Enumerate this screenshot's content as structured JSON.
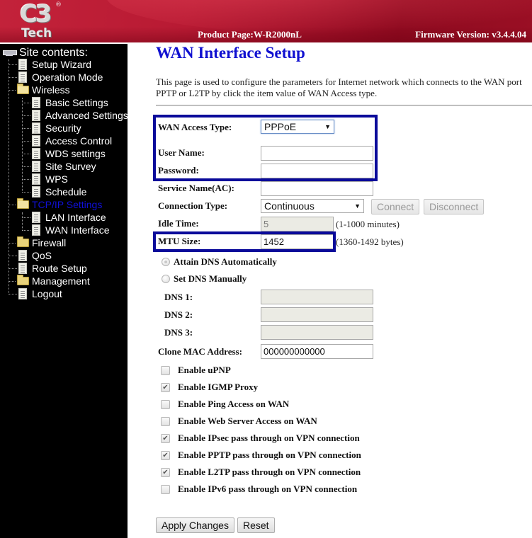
{
  "header": {
    "logo_main": "C3",
    "logo_sub": "Tech",
    "logo_reg": "®",
    "product": "Product Page:W-R2000nL",
    "firmware": "Firmware Version: v3.4.4.04"
  },
  "sidebar": {
    "root_label": "Site contents:",
    "items": [
      {
        "label": "Setup Wizard",
        "icon": "document-icon"
      },
      {
        "label": "Operation Mode",
        "icon": "document-icon"
      },
      {
        "label": "Wireless",
        "icon": "folder-open-icon"
      },
      {
        "label": "Basic Settings",
        "icon": "document-icon"
      },
      {
        "label": "Advanced Settings",
        "icon": "document-icon"
      },
      {
        "label": "Security",
        "icon": "document-icon"
      },
      {
        "label": "Access Control",
        "icon": "document-icon"
      },
      {
        "label": "WDS settings",
        "icon": "document-icon"
      },
      {
        "label": "Site Survey",
        "icon": "document-icon"
      },
      {
        "label": "WPS",
        "icon": "document-icon"
      },
      {
        "label": "Schedule",
        "icon": "document-icon"
      },
      {
        "label": "TCP/IP Settings",
        "icon": "folder-open-icon",
        "active": true
      },
      {
        "label": "LAN Interface",
        "icon": "document-icon"
      },
      {
        "label": "WAN Interface",
        "icon": "document-icon"
      },
      {
        "label": "Firewall",
        "icon": "folder-icon"
      },
      {
        "label": "QoS",
        "icon": "document-icon"
      },
      {
        "label": "Route Setup",
        "icon": "document-icon"
      },
      {
        "label": "Management",
        "icon": "folder-icon"
      },
      {
        "label": "Logout",
        "icon": "document-icon"
      }
    ]
  },
  "main": {
    "title": "WAN Interface Setup",
    "description_line1": "This page is used to configure the parameters for Internet network which connects to the WAN port",
    "description_line2": "PPTP or L2TP by click the item value of WAN Access type.",
    "form": {
      "wan_access_type": {
        "label": "WAN Access Type:",
        "value": "PPPoE"
      },
      "user_name": {
        "label": "User Name:",
        "value": ""
      },
      "password": {
        "label": "Password:",
        "value": ""
      },
      "service_name": {
        "label": "Service Name(AC):",
        "value": ""
      },
      "connection_type": {
        "label": "Connection Type:",
        "value": "Continuous"
      },
      "connect_button": "Connect",
      "disconnect_button": "Disconnect",
      "idle_time": {
        "label": "Idle Time:",
        "value": "5",
        "hint": "(1-1000 minutes)"
      },
      "mtu_size": {
        "label": "MTU Size:",
        "value": "1452",
        "hint": "(1360-1492 bytes)"
      },
      "dns_auto": {
        "label": "Attain DNS Automatically",
        "checked": true
      },
      "dns_manual": {
        "label": "Set DNS Manually",
        "checked": false
      },
      "dns1": {
        "label": "DNS 1:",
        "value": ""
      },
      "dns2": {
        "label": "DNS 2:",
        "value": ""
      },
      "dns3": {
        "label": "DNS 3:",
        "value": ""
      },
      "clone_mac": {
        "label": "Clone MAC Address:",
        "value": "000000000000"
      },
      "checkboxes": [
        {
          "label": "Enable uPNP",
          "checked": false
        },
        {
          "label": "Enable IGMP Proxy",
          "checked": true
        },
        {
          "label": "Enable Ping Access on WAN",
          "checked": false
        },
        {
          "label": "Enable Web Server Access on WAN",
          "checked": false
        },
        {
          "label": "Enable IPsec pass through on VPN connection",
          "checked": true
        },
        {
          "label": "Enable PPTP pass through on VPN connection",
          "checked": true
        },
        {
          "label": "Enable L2TP pass through on VPN connection",
          "checked": true
        },
        {
          "label": "Enable IPv6 pass through on VPN connection",
          "checked": false
        }
      ],
      "apply_button": "Apply Changes",
      "reset_button": "Reset"
    }
  },
  "colors": {
    "header_red": "#b81a33",
    "sidebar_bg": "#000000",
    "title_blue": "#1010d0",
    "active_nav": "#1010d8",
    "highlight_border": "#0a0a9a"
  }
}
